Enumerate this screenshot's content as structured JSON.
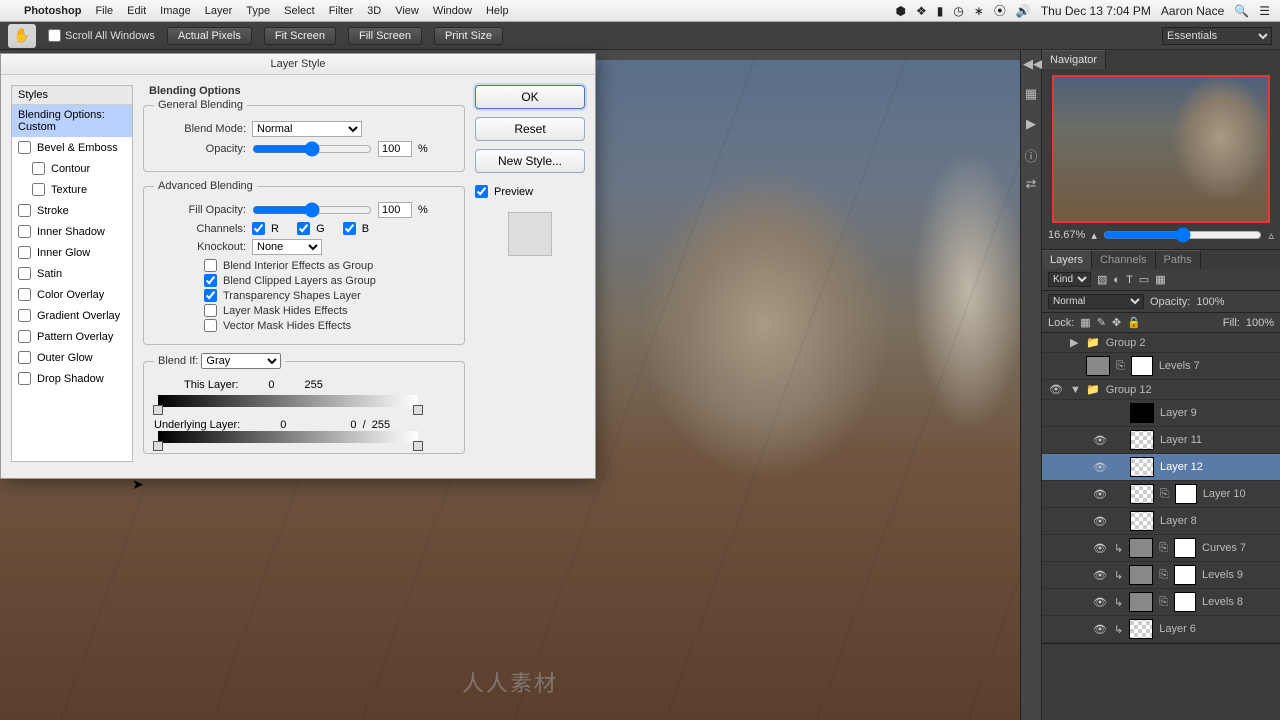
{
  "menubar": {
    "app": "Photoshop",
    "items": [
      "File",
      "Edit",
      "Image",
      "Layer",
      "Type",
      "Select",
      "Filter",
      "3D",
      "View",
      "Window",
      "Help"
    ],
    "clock": "Thu Dec 13  7:04 PM",
    "user": "Aaron Nace"
  },
  "options": {
    "scroll_all": "Scroll All Windows",
    "buttons": [
      "Actual Pixels",
      "Fit Screen",
      "Fill Screen",
      "Print Size"
    ],
    "workspace": "Essentials"
  },
  "navigator": {
    "title": "Navigator",
    "zoom": "16.67%"
  },
  "layers_panel": {
    "tabs": [
      "Layers",
      "Channels",
      "Paths"
    ],
    "kind": "Kind",
    "blend_mode": "Normal",
    "opacity_label": "Opacity:",
    "opacity_value": "100%",
    "fill_label": "Fill:",
    "fill_value": "100%",
    "lock_label": "Lock:",
    "layers": [
      {
        "type": "group",
        "name": "Group 2",
        "expanded": false,
        "visible": false
      },
      {
        "type": "adj",
        "name": "Levels 7",
        "visible": false,
        "mask": true
      },
      {
        "type": "group",
        "name": "Group 12",
        "expanded": true,
        "visible": true
      },
      {
        "type": "layer",
        "name": "Layer 9",
        "visible": false,
        "indent": 1,
        "black": true
      },
      {
        "type": "layer",
        "name": "Layer 11",
        "visible": true,
        "indent": 1,
        "trans": true
      },
      {
        "type": "layer",
        "name": "Layer 12",
        "visible": true,
        "indent": 1,
        "selected": true,
        "trans": true
      },
      {
        "type": "layer",
        "name": "Layer 10",
        "visible": true,
        "indent": 1,
        "trans": true,
        "mask": true
      },
      {
        "type": "layer",
        "name": "Layer 8",
        "visible": true,
        "indent": 1,
        "trans": true
      },
      {
        "type": "adj",
        "name": "Curves 7",
        "visible": true,
        "indent": 1,
        "clip": true,
        "mask": true
      },
      {
        "type": "adj",
        "name": "Levels 9",
        "visible": true,
        "indent": 1,
        "clip": true,
        "mask": true
      },
      {
        "type": "adj",
        "name": "Levels 8",
        "visible": true,
        "indent": 1,
        "clip": true,
        "mask": true
      },
      {
        "type": "layer",
        "name": "Layer 6",
        "visible": true,
        "indent": 1,
        "clip": true,
        "trans": true
      }
    ]
  },
  "dialog": {
    "title": "Layer Style",
    "styles_head": "Styles",
    "styles_selected": "Blending Options: Custom",
    "styles": [
      "Bevel & Emboss",
      "Contour",
      "Texture",
      "Stroke",
      "Inner Shadow",
      "Inner Glow",
      "Satin",
      "Color Overlay",
      "Gradient Overlay",
      "Pattern Overlay",
      "Outer Glow",
      "Drop Shadow"
    ],
    "blending_options": "Blending Options",
    "general": {
      "legend": "General Blending",
      "blend_mode_label": "Blend Mode:",
      "blend_mode": "Normal",
      "opacity_label": "Opacity:",
      "opacity": "100",
      "pct": "%"
    },
    "advanced": {
      "legend": "Advanced Blending",
      "fill_opacity_label": "Fill Opacity:",
      "fill_opacity": "100",
      "channels_label": "Channels:",
      "ch_r": "R",
      "ch_g": "G",
      "ch_b": "B",
      "knockout_label": "Knockout:",
      "knockout": "None",
      "cb1": "Blend Interior Effects as Group",
      "cb2": "Blend Clipped Layers as Group",
      "cb3": "Transparency Shapes Layer",
      "cb4": "Layer Mask Hides Effects",
      "cb5": "Vector Mask Hides Effects"
    },
    "blendif": {
      "label": "Blend If:",
      "mode": "Gray",
      "this_label": "This Layer:",
      "this_lo": "0",
      "this_hi": "255",
      "under_label": "Underlying Layer:",
      "under_lo": "0",
      "under_sep": "/",
      "under_hi": "255"
    },
    "buttons": {
      "ok": "OK",
      "reset": "Reset",
      "newstyle": "New Style...",
      "preview": "Preview"
    }
  },
  "watermark": "人人素材"
}
